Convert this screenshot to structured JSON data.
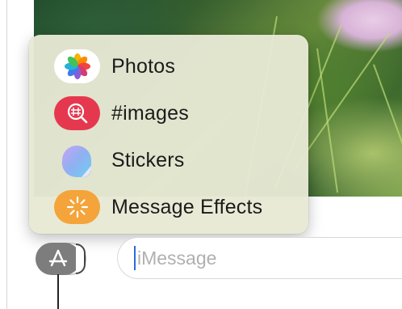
{
  "menu": {
    "items": [
      {
        "label": "Photos",
        "icon": "photos-icon"
      },
      {
        "label": "#images",
        "icon": "images-search-icon",
        "color": "#e5384f"
      },
      {
        "label": "Stickers",
        "icon": "stickers-icon"
      },
      {
        "label": "Message Effects",
        "icon": "message-effects-icon",
        "color": "#f4a43a"
      }
    ]
  },
  "composer": {
    "placeholder": "iMessage",
    "apps_button_icon": "app-store-icon"
  },
  "colors": {
    "accent": "#2a6ae0",
    "menu_background": "#e7e9d4"
  }
}
